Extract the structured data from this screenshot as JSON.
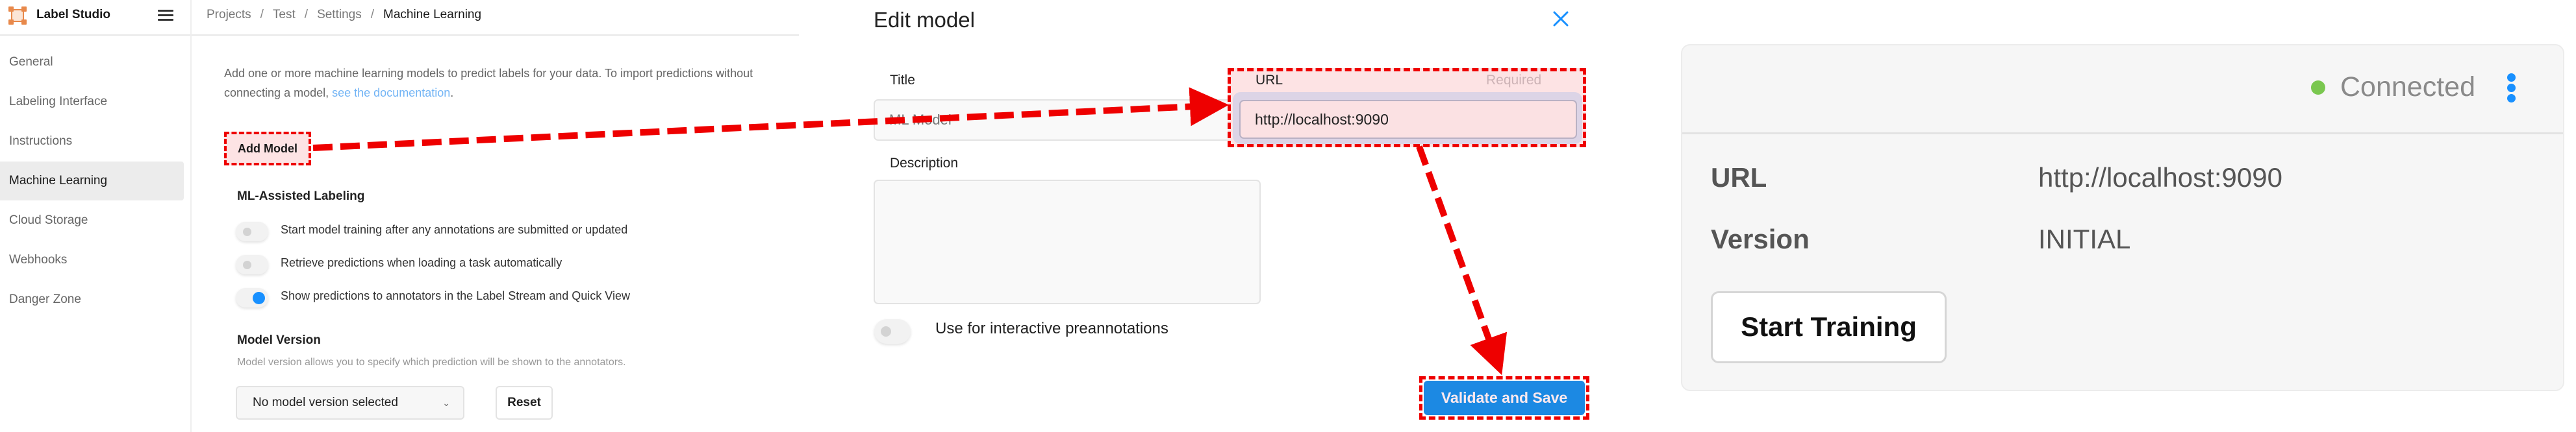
{
  "app": {
    "brand": "Label Studio",
    "breadcrumb": [
      "Projects",
      "Test",
      "Settings",
      "Machine Learning"
    ],
    "breadcrumb_separator": "/"
  },
  "sidebar": {
    "active": "Machine Learning",
    "items": [
      {
        "label": "General"
      },
      {
        "label": "Labeling Interface"
      },
      {
        "label": "Instructions"
      },
      {
        "label": "Machine Learning"
      },
      {
        "label": "Cloud Storage"
      },
      {
        "label": "Webhooks"
      },
      {
        "label": "Danger Zone"
      }
    ]
  },
  "ml_settings": {
    "intro_text": "Add one or more machine learning models to predict labels for your data. To import predictions without connecting a model,",
    "intro_link": "see the documentation",
    "intro_end": ".",
    "add_model_label": "Add Model",
    "assisted_heading": "ML-Assisted Labeling",
    "toggles": [
      {
        "label": "Start model training after any annotations are submitted or updated",
        "on": false
      },
      {
        "label": "Retrieve predictions when loading a task automatically",
        "on": false
      },
      {
        "label": "Show predictions to annotators in the Label Stream and Quick View",
        "on": true
      }
    ],
    "model_version_heading": "Model Version",
    "model_version_hint": "Model version allows you to specify which prediction will be shown to the annotators.",
    "model_version_select": "No model version selected",
    "reset_label": "Reset"
  },
  "edit_modal": {
    "title": "Edit model",
    "title_field_label": "Title",
    "title_field_placeholder": "ML Model",
    "url_field_label": "URL",
    "url_required": "Required",
    "url_value": "http://localhost:9090",
    "description_label": "Description",
    "description_value": "",
    "interactive_label": "Use for interactive preannotations",
    "interactive_on": false,
    "submit_label": "Validate and Save"
  },
  "model_card": {
    "status": "Connected",
    "status_color": "#7ac74f",
    "rows": [
      {
        "key": "URL",
        "value": "http://localhost:9090"
      },
      {
        "key": "Version",
        "value": "INITIAL"
      }
    ],
    "train_label": "Start Training"
  },
  "annotation": {
    "highlight_color": "#ee0000"
  }
}
